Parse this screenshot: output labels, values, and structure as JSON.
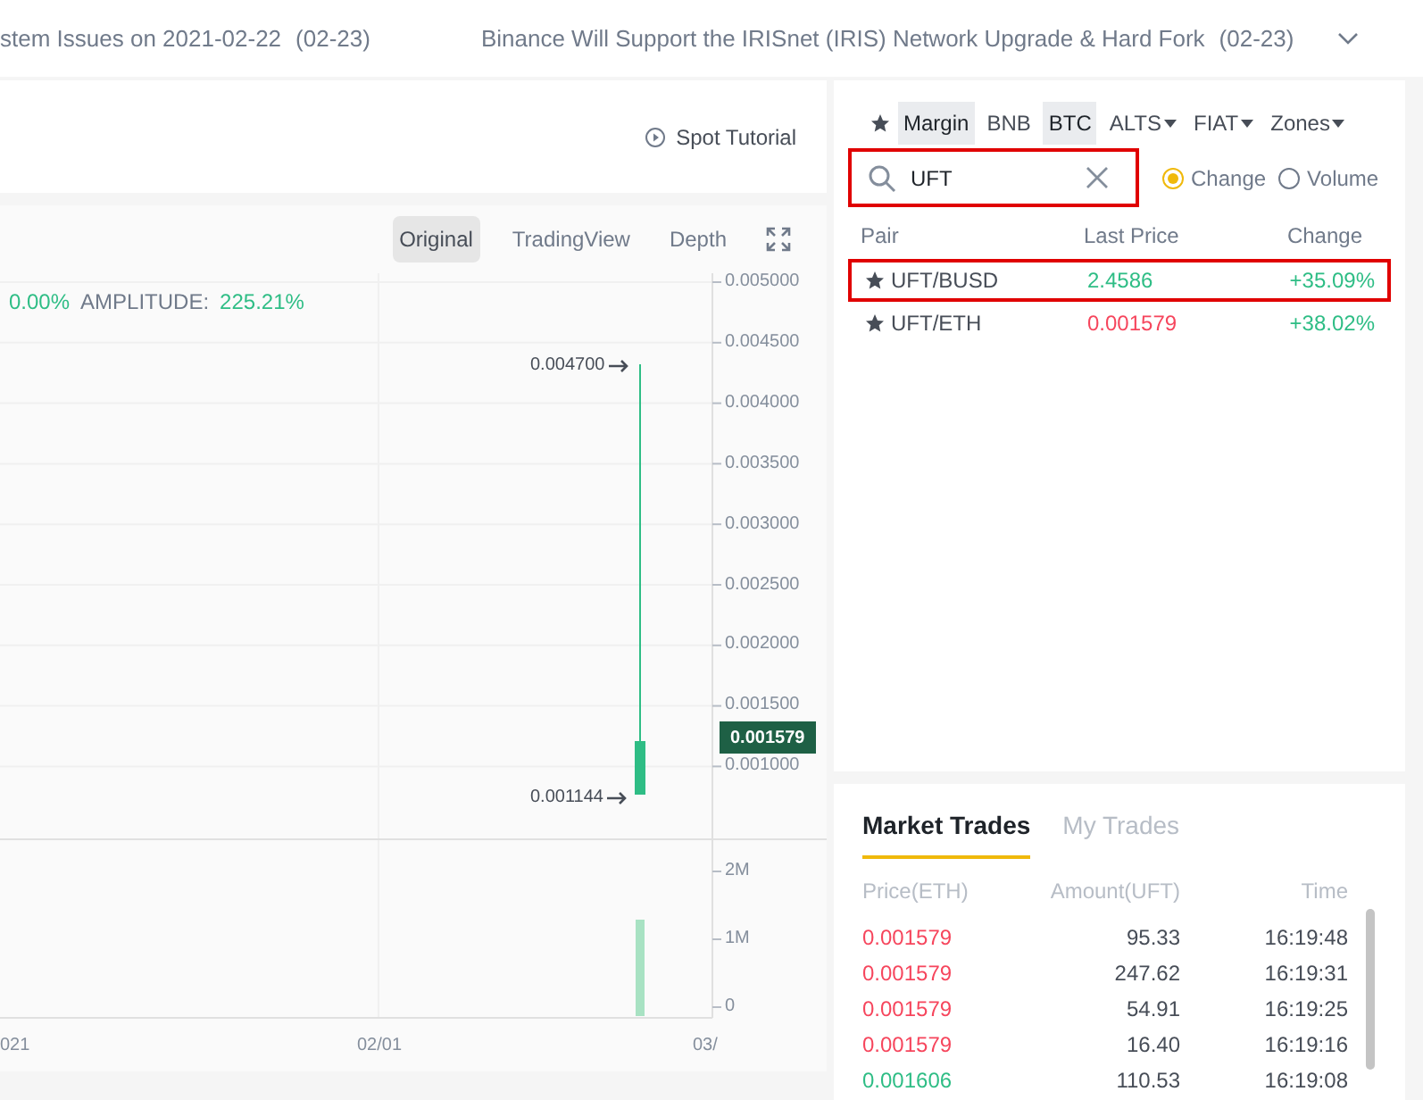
{
  "news": [
    {
      "title": "stem Issues on 2021-02-22",
      "date": "(02-23)"
    },
    {
      "title": "Binance Will Support the IRISnet (IRIS) Network Upgrade & Hard Fork",
      "date": "(02-23)"
    }
  ],
  "tutorial": {
    "label": "Spot Tutorial"
  },
  "chart": {
    "views": [
      {
        "label": "Original",
        "selected": true
      },
      {
        "label": "TradingView",
        "selected": false
      },
      {
        "label": "Depth",
        "selected": false
      }
    ],
    "stats": [
      {
        "kind": "value",
        "text": "0.00%"
      },
      {
        "kind": "label",
        "text": "AMPLITUDE:"
      },
      {
        "kind": "value",
        "text": "225.21%"
      }
    ],
    "price_ticks": [
      "0.005000",
      "0.004500",
      "0.004000",
      "0.003500",
      "0.003000",
      "0.002500",
      "0.002000",
      "0.001500",
      "0.001000"
    ],
    "volume_ticks": [
      "2M",
      "1M",
      "0"
    ],
    "date_ticks": [
      "021",
      "02/01",
      "03/"
    ],
    "high_label": "0.004700",
    "low_label": "0.001144",
    "last_price": "0.001579"
  },
  "markets": {
    "tabs": [
      {
        "label": "Margin",
        "selected": true,
        "dropdown": false
      },
      {
        "label": "BNB",
        "selected": false,
        "dropdown": false
      },
      {
        "label": "BTC",
        "selected": true,
        "dropdown": false
      },
      {
        "label": "ALTS",
        "selected": false,
        "dropdown": true
      },
      {
        "label": "FIAT",
        "selected": false,
        "dropdown": true
      },
      {
        "label": "Zones",
        "selected": false,
        "dropdown": true
      }
    ],
    "search": {
      "value": "UFT",
      "highlighted": true
    },
    "sort": [
      {
        "label": "Change",
        "selected": true
      },
      {
        "label": "Volume",
        "selected": false
      }
    ],
    "columns": [
      "Pair",
      "Last Price",
      "Change"
    ],
    "rows": [
      {
        "pair": "UFT/BUSD",
        "price": "2.4586",
        "change": "+35.09%",
        "color": "#2ebd85",
        "highlighted": true
      },
      {
        "pair": "UFT/ETH",
        "price": "0.001579",
        "change": "+38.02%",
        "color": "#f6465d",
        "highlighted": false
      }
    ]
  },
  "trades": {
    "tabs": [
      {
        "label": "Market Trades",
        "selected": true
      },
      {
        "label": "My Trades",
        "selected": false
      }
    ],
    "columns": [
      "Price(ETH)",
      "Amount(UFT)",
      "Time"
    ],
    "rows": [
      {
        "price": "0.001579",
        "amount": "95.33",
        "time": "16:19:48",
        "color": "#f6465d"
      },
      {
        "price": "0.001579",
        "amount": "247.62",
        "time": "16:19:31",
        "color": "#f6465d"
      },
      {
        "price": "0.001579",
        "amount": "54.91",
        "time": "16:19:25",
        "color": "#f6465d"
      },
      {
        "price": "0.001579",
        "amount": "16.40",
        "time": "16:19:16",
        "color": "#f6465d"
      },
      {
        "price": "0.001606",
        "amount": "110.53",
        "time": "16:19:08",
        "color": "#2ebd85"
      }
    ]
  }
}
